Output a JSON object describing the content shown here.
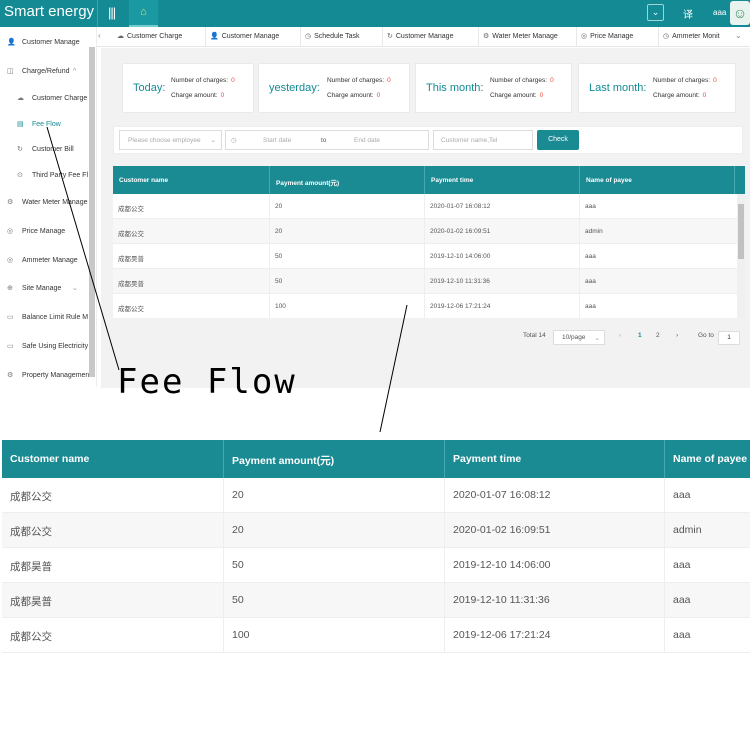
{
  "header": {
    "brand": "Smart energy",
    "menu_icon": "|||",
    "home_icon": "⌂",
    "dropdown_icon": "⌄",
    "translate_icon": "译",
    "user": "aaa",
    "avatar_icon": "☺",
    "accent": "#138a94"
  },
  "sidebar": {
    "items": [
      {
        "label": "Customer Manage",
        "icon": "person-icon",
        "glyph": "👤"
      },
      {
        "label": "Charge/Refund",
        "icon": "charge-icon",
        "glyph": "◫",
        "chevron": "^"
      },
      {
        "label": "Customer Charge",
        "icon": "cloud-icon",
        "glyph": "☁"
      },
      {
        "label": "Fee Flow",
        "icon": "doc-icon",
        "glyph": "▤"
      },
      {
        "label": "Customer Bill",
        "icon": "refresh-icon",
        "glyph": "↻"
      },
      {
        "label": "Third Party Fee Fl",
        "icon": "pin-icon",
        "glyph": "⊙"
      },
      {
        "label": "Water Meter Manage",
        "icon": "settings-icon",
        "glyph": "⚙"
      },
      {
        "label": "Price Manage",
        "icon": "price-icon",
        "glyph": "◎"
      },
      {
        "label": "Ammeter Manage",
        "icon": "meter-icon",
        "glyph": "◎"
      },
      {
        "label": "Site Manage",
        "icon": "site-icon",
        "glyph": "⊕",
        "chevron": "⌄"
      },
      {
        "label": "Balance Limit Rule M",
        "icon": "rule-icon",
        "glyph": "▭"
      },
      {
        "label": "Safe Using Electricity",
        "icon": "safe-icon",
        "glyph": "▭"
      },
      {
        "label": "Property Managemen",
        "icon": "property-icon",
        "glyph": "⚙"
      }
    ]
  },
  "tabs": {
    "prev": "‹",
    "next": "⌄",
    "items": [
      {
        "label": "Customer Charge",
        "glyph": "☁"
      },
      {
        "label": "Customer Manage",
        "glyph": "👤"
      },
      {
        "label": "Schedule Task",
        "glyph": "◷"
      },
      {
        "label": "Customer Manage",
        "glyph": "↻"
      },
      {
        "label": "Water Meter Manage",
        "glyph": "⚙"
      },
      {
        "label": "Price Manage",
        "glyph": "◎"
      },
      {
        "label": "Ammeter Monit",
        "glyph": "◷"
      }
    ]
  },
  "stats": [
    {
      "title": "Today:",
      "charges_label": "Number of charges:",
      "charges": "0",
      "amount_label": "Charge amount:",
      "amount": "0"
    },
    {
      "title": "yesterday:",
      "charges_label": "Number of charges:",
      "charges": "0",
      "amount_label": "Charge amount:",
      "amount": "0"
    },
    {
      "title": "This month:",
      "charges_label": "Number of charges:",
      "charges": "0",
      "amount_label": "Charge amount:",
      "amount": "0"
    },
    {
      "title": "Last month:",
      "charges_label": "Number of charges:",
      "charges": "0",
      "amount_label": "Charge amount:",
      "amount": "0"
    }
  ],
  "filter": {
    "employee_placeholder": "Please choose employee",
    "calendar_icon": "◷",
    "start_placeholder": "Start date",
    "to": "to",
    "end_placeholder": "End date",
    "name_placeholder": "Customer name,Tel",
    "check": "Check"
  },
  "table": {
    "columns": [
      "Customer name",
      "Payment amount(元)",
      "Payment time",
      "Name of payee"
    ],
    "rows": [
      [
        "成都公交",
        "20",
        "2020-01-07 16:08:12",
        "aaa"
      ],
      [
        "成都公交",
        "20",
        "2020-01-02 16:09:51",
        "admin"
      ],
      [
        "成都昊普",
        "50",
        "2019-12-10 14:06:00",
        "aaa"
      ],
      [
        "成都昊普",
        "50",
        "2019-12-10 11:31:36",
        "aaa"
      ],
      [
        "成都公交",
        "100",
        "2019-12-06 17:21:24",
        "aaa"
      ]
    ]
  },
  "pagination": {
    "total": "Total 14",
    "page_size": "10/page",
    "prev": "‹",
    "pages": [
      "1",
      "2"
    ],
    "next": "›",
    "goto": "Go to",
    "goto_value": "1"
  },
  "annotation": {
    "callout": "Fee Flow"
  }
}
